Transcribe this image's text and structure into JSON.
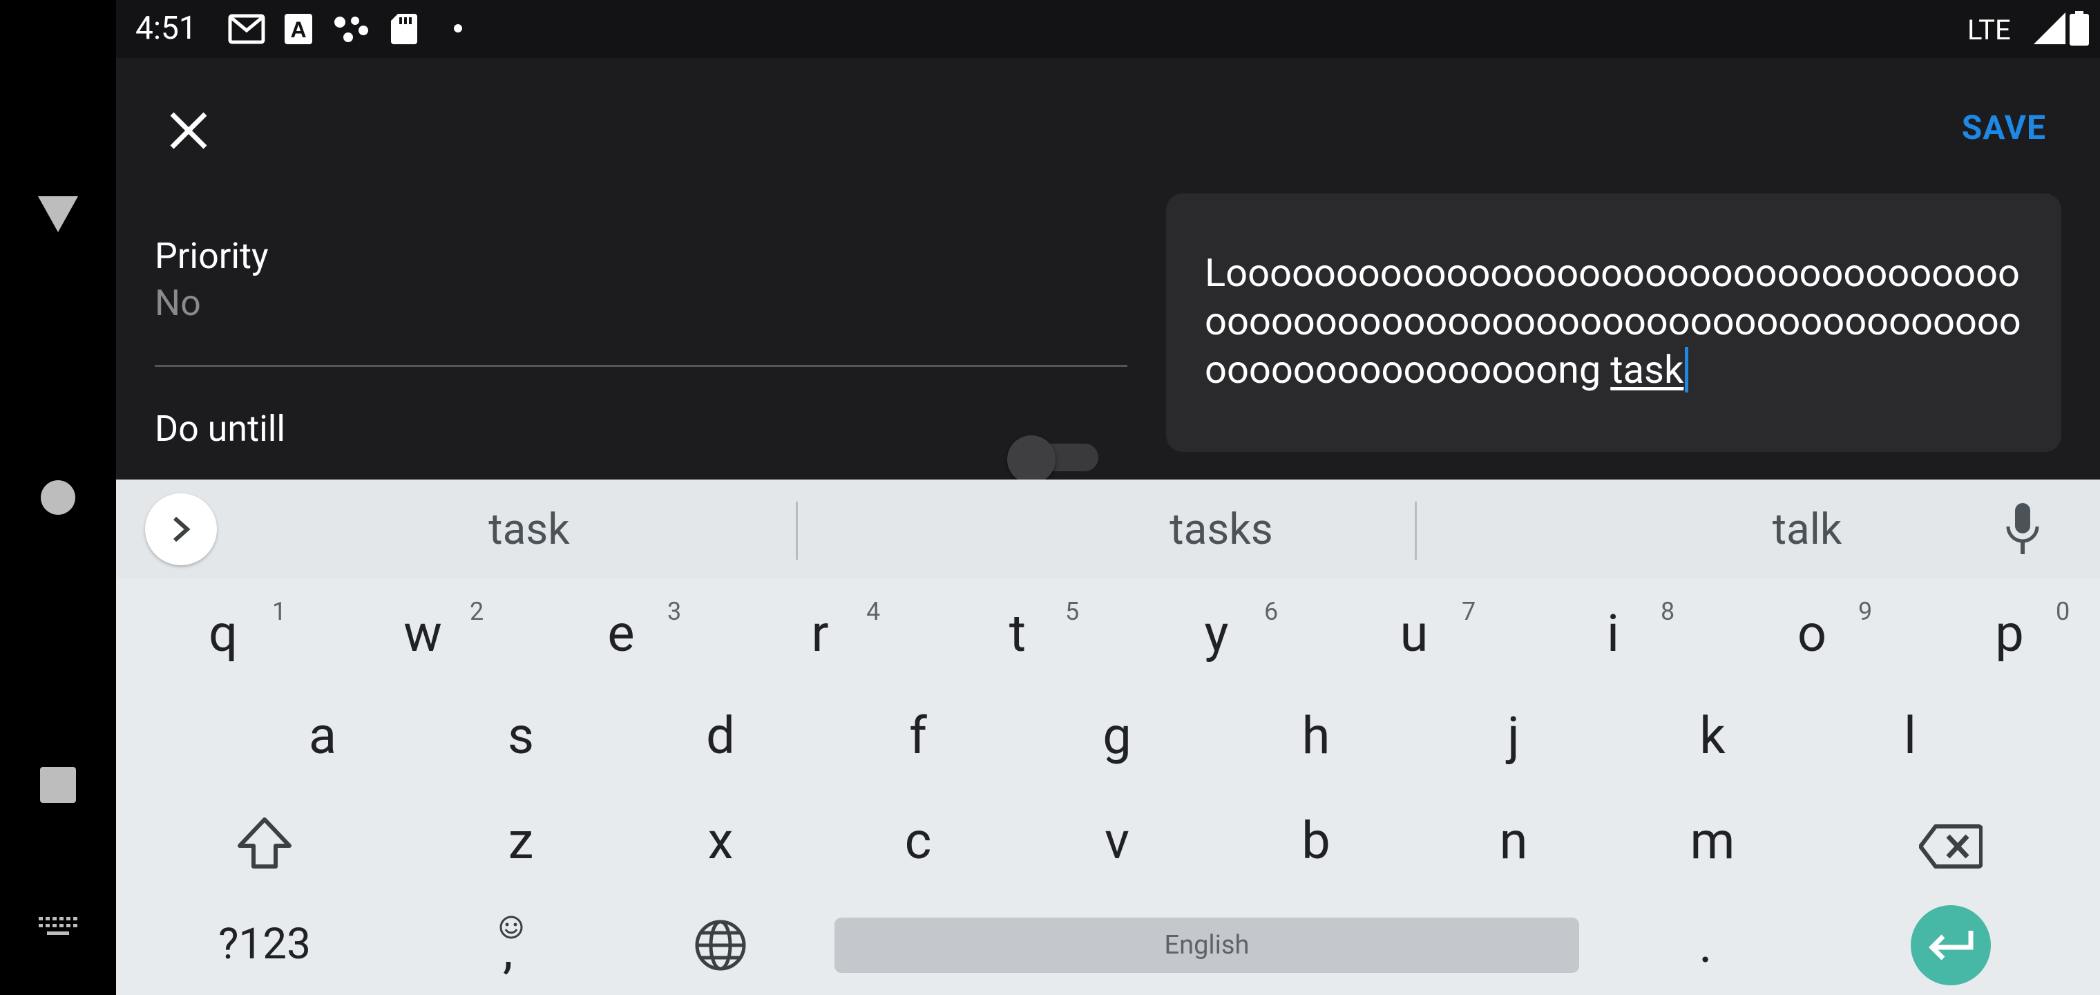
{
  "status_bar": {
    "time": "4:51",
    "network": "LTE"
  },
  "app": {
    "save_label": "SAVE",
    "priority_label": "Priority",
    "priority_value": "No",
    "do_until_label": "Do untill",
    "task_text_prefix": "Looooooooooooooooooooooooooooooooooooooooooooooooooooooooooooooooooooooooooooooooooooooooong ",
    "task_text_current_word": "task"
  },
  "keyboard": {
    "suggestions": [
      "task",
      "tasks",
      "talk"
    ],
    "row1": [
      {
        "key": "q",
        "hint": "1"
      },
      {
        "key": "w",
        "hint": "2"
      },
      {
        "key": "e",
        "hint": "3"
      },
      {
        "key": "r",
        "hint": "4"
      },
      {
        "key": "t",
        "hint": "5"
      },
      {
        "key": "y",
        "hint": "6"
      },
      {
        "key": "u",
        "hint": "7"
      },
      {
        "key": "i",
        "hint": "8"
      },
      {
        "key": "o",
        "hint": "9"
      },
      {
        "key": "p",
        "hint": "0"
      }
    ],
    "row2": [
      "a",
      "s",
      "d",
      "f",
      "g",
      "h",
      "j",
      "k",
      "l"
    ],
    "row3": [
      "z",
      "x",
      "c",
      "v",
      "b",
      "n",
      "m"
    ],
    "symbols_label": "?123",
    "comma_label": ",",
    "space_label": "English",
    "period_label": ".",
    "accent_color": "#47b8a6"
  },
  "colors": {
    "save": "#1e88e5",
    "caret": "#1e88e5"
  }
}
